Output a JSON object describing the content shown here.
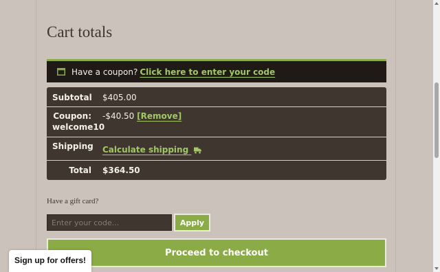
{
  "cart_totals": {
    "title": "Cart totals",
    "coupon_prompt": {
      "text": "Have a coupon?",
      "link": "Click here to enter your code",
      "icon": "coupon-icon"
    },
    "rows": {
      "subtotal": {
        "label": "Subtotal",
        "value": "$405.00"
      },
      "coupon": {
        "label_line1": "Coupon:",
        "label_line2": "welcome10",
        "value": "-$40.50",
        "remove_link": "[Remove]"
      },
      "shipping": {
        "label": "Shipping",
        "link": "Calculate shipping",
        "icon": "truck-icon"
      },
      "total": {
        "label": "Total",
        "value": "$364.50"
      }
    },
    "gift_card": {
      "label": "Have a gift card?",
      "placeholder": "Enter your code...",
      "apply_label": "Apply"
    },
    "checkout_label": "Proceed to checkout"
  },
  "signup_popup": {
    "label": "Sign up for offers!"
  },
  "colors": {
    "accent": "#8aab45",
    "link": "#a2c765",
    "panel": "#3f372f",
    "coupon_bar": "#1f1a16",
    "background": "#cbc3bb"
  }
}
